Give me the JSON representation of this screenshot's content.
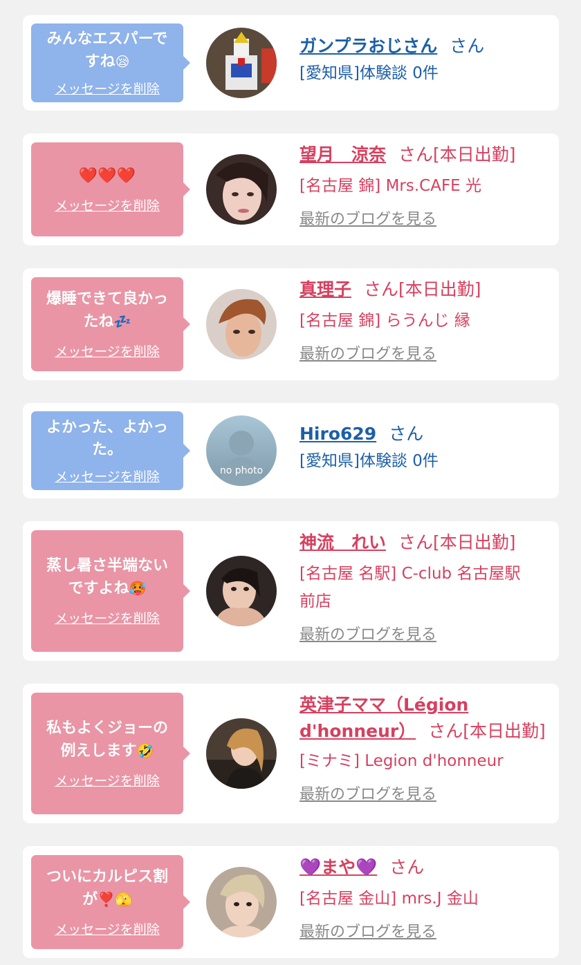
{
  "delete_label": "メッセージを削除",
  "blog_label": "最新のブログを見る",
  "colors": {
    "blue_bubble": "#8fb3eb",
    "pink_bubble": "#ea95a6",
    "blue_text": "#1c5fa8",
    "pink_text": "#d6405f"
  },
  "messages": [
    {
      "text_1": "みんなエスパーで",
      "text_2": "すね",
      "emoji": "😪",
      "username": "ガンプラおじさん",
      "suffix": "さん",
      "location": "[愛知県]体験談 0件",
      "avatar": "gundam-avatar"
    },
    {
      "text_1": "",
      "text_2": "",
      "emoji": "❤️❤️❤️",
      "username": "望月　涼奈",
      "suffix": "さん[本日出勤]",
      "location": "[名古屋 錦] Mrs.CAFE 光",
      "avatar": "woman-avatar"
    },
    {
      "text_1": "爆睡できて良かっ",
      "text_2": "たね",
      "emoji": "💤",
      "username": "真理子",
      "suffix": "さん[本日出勤]",
      "location": "[名古屋 錦] らうんじ 縁",
      "avatar": "woman-avatar"
    },
    {
      "text_1": "よかった、よかっ",
      "text_2": "た。",
      "emoji": "",
      "username": "Hiro629",
      "suffix": "さん",
      "location": "[愛知県]体験談 0件",
      "avatar": "no-photo-avatar",
      "avatar_text": "no photo"
    },
    {
      "text_1": "蒸し暑さ半端ない",
      "text_2": "ですよね",
      "emoji": "🥵",
      "username": "神流　れい",
      "suffix": "さん[本日出勤]",
      "location_1": "[名古屋 名駅] C-club 名古屋駅",
      "location_2": "前店",
      "avatar": "woman-avatar"
    },
    {
      "text_1": "私もよくジョーの",
      "text_2": "例えします",
      "emoji": "🤣",
      "username_1": "英津子ママ（Légion",
      "username_2": "d'honneur）",
      "suffix": "さん[本日出勤]",
      "location": "[ミナミ] Legion d'honneur",
      "avatar": "woman-avatar"
    },
    {
      "text_1": "ついにカルピス割",
      "text_2": "が",
      "emoji": "❣️🫣",
      "username": "まや",
      "username_emoji": "💜",
      "suffix": "さん",
      "location": "[名古屋 金山] mrs.J 金山",
      "avatar": "woman-avatar"
    }
  ]
}
